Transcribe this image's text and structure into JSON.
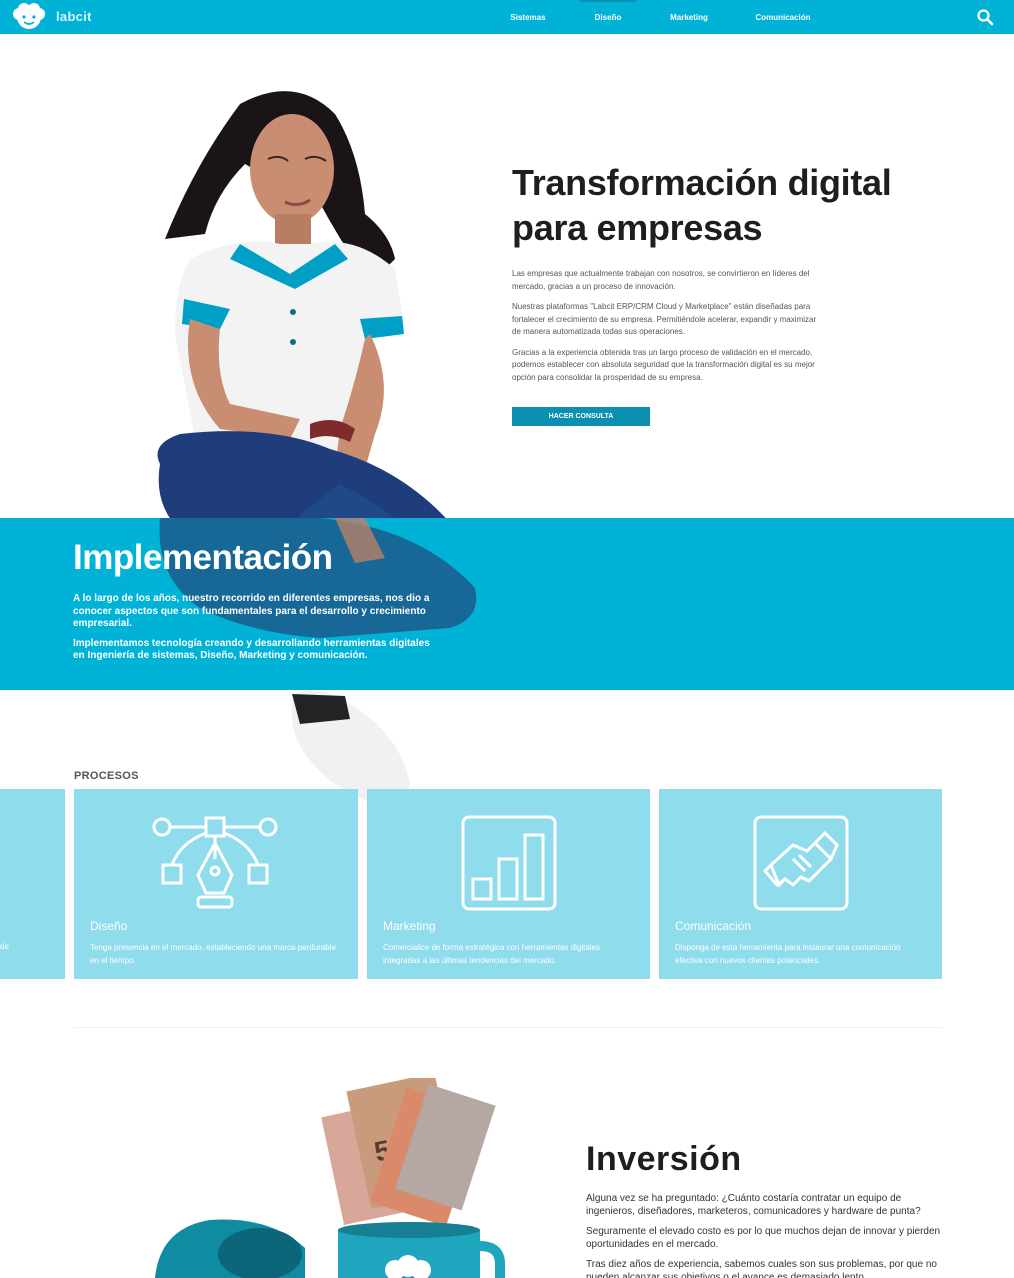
{
  "colors": {
    "primary": "#00b3d6",
    "primary_dark": "#0a8fb0",
    "card": "#8fdcec"
  },
  "nav": {
    "logo_text": "labcit",
    "items": [
      {
        "label": "Sistemas",
        "active": false
      },
      {
        "label": "Diseño",
        "active": true
      },
      {
        "label": "Marketing",
        "active": false
      },
      {
        "label": "Comunicación",
        "active": false
      }
    ],
    "search_icon": "search-icon"
  },
  "hero": {
    "title": "Transformación digital para empresas",
    "paragraphs": [
      "Las empresas que actualmente trabajan con nosotros, se convirtieron en líderes del mercado, gracias a un proceso de innovación.",
      "Nuestras plataformas \"Labcit ERP/CRM Cloud y Marketplace\" están diseñadas para fortalecer el crecimiento de su empresa. Permitiéndole acelerar, expandir y maximizar de manera automatizada todas sus operaciones.",
      "Gracias a la experiencia obtenida tras un largo proceso de validación en el mercado, podemos establecer con absoluta seguridad que la transformación digital es su mejor opción para consolidar la prosperidad de su empresa."
    ],
    "cta_label": "HACER CONSULTA"
  },
  "implementation": {
    "title": "Implementación",
    "paragraphs": [
      "A lo largo de los años, nuestro recorrido en diferentes empresas, nos dio a conocer aspectos que son fundamentales para el desarrollo y crecimiento empresarial.",
      "Implementamos tecnología creando y desarrollando herramientas digitales en Ingeniería de sistemas, Diseño, Marketing y comunicación."
    ]
  },
  "processes": {
    "label": "PROCESOS",
    "partial_card_text": "de",
    "cards": [
      {
        "title": "Diseño",
        "text": "Tenga presencia en el mercado, estableciendo una marca perdurable en el tiempo.",
        "icon": "pen-tool-icon"
      },
      {
        "title": "Marketing",
        "text": "Comercialice de forma estratégica con herramientas digitales integradas a las últimas tendencias del mercado.",
        "icon": "bar-chart-icon"
      },
      {
        "title": "Comunicación",
        "text": "Disponga de esta herramienta para instaurar una comunicación efectiva con nuevos clientes potenciales.",
        "icon": "handshake-icon"
      }
    ]
  },
  "investment": {
    "title": "Inversión",
    "paragraphs": [
      "Alguna vez se ha preguntado: ¿Cuánto costaría contratar un equipo de ingenieros, diseñadores, marketeros, comunicadores y hardware de punta?",
      "Seguramente el elevado costo es por lo que muchos dejan de innovar y pierden oportunidades en el mercado.",
      "Tras diez años de experiencia, sabemos cuales son sus problemas, por que no pueden alcanzar sus objetivos o el avance es demasiado lento."
    ],
    "art": "mugs-with-money-image"
  }
}
